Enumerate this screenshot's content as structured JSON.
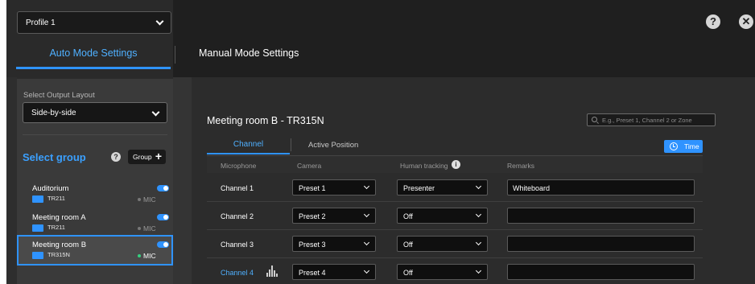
{
  "header": {
    "profile_value": "Profile 1",
    "help_glyph": "?",
    "close_glyph": "✕",
    "tabs": [
      {
        "label": "Auto Mode Settings",
        "active": true
      },
      {
        "label": "Manual Mode Settings",
        "active": false
      }
    ]
  },
  "sidebar": {
    "output_layout_label": "Select Output Layout",
    "output_layout_value": "Side-by-side",
    "select_group_label": "Select group",
    "help_glyph": "?",
    "group_button_label": "Group",
    "group_button_plus": "+",
    "rooms": [
      {
        "name": "Auditorium",
        "device": "TR211",
        "enabled": true,
        "mic_label": "MIC",
        "mic_active": false
      },
      {
        "name": "Meeting room A",
        "device": "TR211",
        "enabled": true,
        "mic_label": "MIC",
        "mic_active": false
      },
      {
        "name": "Meeting room B",
        "device": "TR315N",
        "enabled": true,
        "mic_label": "MIC",
        "mic_active": true
      }
    ]
  },
  "main": {
    "room_title": "Meeting room B - TR315N",
    "search_placeholder": "E.g., Preset 1, Channel 2 or Zone",
    "sub_tabs": [
      {
        "label": "Channel",
        "active": true
      },
      {
        "label": "Active Position",
        "active": false
      }
    ],
    "time_button_label": "Time",
    "columns": [
      "Microphone",
      "Camera",
      "Human tracking",
      "Remarks"
    ],
    "info_glyph": "i",
    "rows": [
      {
        "channel": "Channel 1",
        "camera": "Preset 1",
        "tracking": "Presenter",
        "remarks": "Whiteboard",
        "active": false
      },
      {
        "channel": "Channel 2",
        "camera": "Preset 2",
        "tracking": "Off",
        "remarks": "",
        "active": false
      },
      {
        "channel": "Channel 3",
        "camera": "Preset 3",
        "tracking": "Off",
        "remarks": "",
        "active": false
      },
      {
        "channel": "Channel 4",
        "camera": "Preset 4",
        "tracking": "Off",
        "remarks": "",
        "active": true
      }
    ]
  },
  "colors": {
    "accent": "#2f93ff",
    "background": "#2b2b2b",
    "topbar": "#1f1f1f"
  },
  "icons": [
    "chevron-down-icon",
    "help-icon",
    "close-icon",
    "plus-icon",
    "room-device-icon",
    "search-icon",
    "clock-icon",
    "info-icon",
    "mic-level-icon"
  ]
}
